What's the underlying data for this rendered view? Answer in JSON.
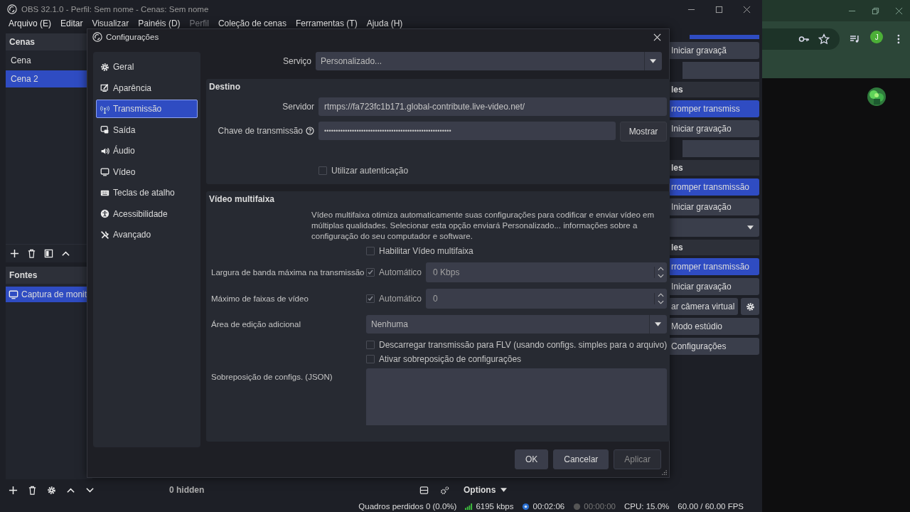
{
  "main_window": {
    "title": "OBS 32.1.0 - Perfil: Sem nome - Cenas: Sem nome",
    "menu": [
      {
        "label": "Arquivo (E)",
        "disabled": false
      },
      {
        "label": "Editar",
        "disabled": false
      },
      {
        "label": "Visualizar",
        "disabled": false
      },
      {
        "label": "Painéis (D)",
        "disabled": false
      },
      {
        "label": "Perfil",
        "disabled": true
      },
      {
        "label": "Coleção de cenas",
        "disabled": false
      },
      {
        "label": "Ferramentas (T)",
        "disabled": false
      },
      {
        "label": "Ajuda (H)",
        "disabled": false
      }
    ],
    "scenes": {
      "title": "Cenas",
      "items": [
        {
          "label": "Cena",
          "selected": false
        },
        {
          "label": "Cena 2",
          "selected": true
        }
      ]
    },
    "sources": {
      "title": "Fontes",
      "items": [
        {
          "label": "Captura de monit",
          "selected": true
        }
      ]
    },
    "controls_dock": [
      {
        "kind": "bar",
        "selected": true
      },
      {
        "kind": "button",
        "label": "Iniciar gravaçã",
        "selected": false
      },
      {
        "kind": "bar",
        "selected": false
      },
      {
        "kind": "header",
        "label": "les"
      },
      {
        "kind": "button",
        "label": "rromper transmiss",
        "selected": true
      },
      {
        "kind": "button",
        "label": "Iniciar gravação",
        "selected": false
      },
      {
        "kind": "bar",
        "selected": false
      },
      {
        "kind": "header",
        "label": "les"
      },
      {
        "kind": "button",
        "label": "rromper transmissão",
        "selected": true
      },
      {
        "kind": "button",
        "label": "Iniciar gravação",
        "selected": false
      },
      {
        "kind": "dropdown"
      },
      {
        "kind": "header",
        "label": "les"
      },
      {
        "kind": "button",
        "label": "rromper transmissão",
        "selected": true
      },
      {
        "kind": "button",
        "label": "Iniciar gravação",
        "selected": false
      },
      {
        "kind": "gear_button",
        "label": "ar câmera virtual"
      },
      {
        "kind": "button",
        "label": "Modo estúdio",
        "selected": false
      },
      {
        "kind": "button",
        "label": "Configurações",
        "selected": false
      }
    ],
    "hidden_count": "0 hidden",
    "options_label": "Options",
    "status_bar": [
      {
        "kind": "text",
        "label": "Quadros perdidos 0 (0.0%)"
      },
      {
        "kind": "bitrate",
        "label": "6195 kbps"
      },
      {
        "kind": "stream_time",
        "label": "00:02:06"
      },
      {
        "kind": "record_time",
        "label": "00:00:00"
      },
      {
        "kind": "text",
        "label": "CPU: 15.0%"
      },
      {
        "kind": "text",
        "label": "60.00 / 60.00 FPS"
      }
    ]
  },
  "browser": {
    "avatar_letter": "J"
  },
  "dialog": {
    "title": "Configurações",
    "nav": [
      {
        "label": "Geral",
        "selected": false
      },
      {
        "label": "Aparência",
        "selected": false
      },
      {
        "label": "Transmissão",
        "selected": true
      },
      {
        "label": "Saída",
        "selected": false
      },
      {
        "label": "Áudio",
        "selected": false
      },
      {
        "label": "Vídeo",
        "selected": false
      },
      {
        "label": "Teclas de atalho",
        "selected": false
      },
      {
        "label": "Acessibilidade",
        "selected": false
      },
      {
        "label": "Avançado",
        "selected": false
      }
    ],
    "service": {
      "label": "Serviço",
      "value": "Personalizado..."
    },
    "destination": {
      "title": "Destino",
      "server": {
        "label": "Servidor",
        "value": "rtmps://fa723fc1b171.global-contribute.live-video.net/"
      },
      "key": {
        "label": "Chave de transmissão",
        "value": "•••••••••••••••••••••••••••••••••••••••••••••••••••••••",
        "button": "Mostrar"
      },
      "auth": {
        "label": "Utilizar autenticação",
        "checked": false
      }
    },
    "multitrack": {
      "title": "Vídeo multifaixa",
      "description": "Vídeo multifaixa otimiza automaticamente suas configurações para codificar e enviar vídeo em múltiplas qualidades. Selecionar esta opção enviará Personalizado... informações sobre a configuração do seu computador e software.",
      "enable": {
        "label": "Habilitar Vídeo multifaixa",
        "checked": false
      },
      "bandwidth": {
        "label": "Largura de banda máxima na transmissão",
        "auto_label": "Automático",
        "auto_checked": true,
        "value": "0 Kbps"
      },
      "max_tracks": {
        "label": "Máximo de faixas de vídeo",
        "auto_label": "Automático",
        "auto_checked": true,
        "value": "0"
      },
      "extra_canvas": {
        "label": "Área de edição adicional",
        "value": "Nenhuma"
      },
      "dump_flv": {
        "label": "Descarregar transmissão para FLV (usando configs. simples para o arquivo)",
        "checked": false
      },
      "override": {
        "label": "Ativar sobreposição de configurações",
        "checked": false
      },
      "override_json": {
        "label": "Sobreposição de configs. (JSON)"
      }
    },
    "buttons": [
      {
        "label": "OK",
        "disabled": false
      },
      {
        "label": "Cancelar",
        "disabled": false
      },
      {
        "label": "Aplicar",
        "disabled": true
      }
    ]
  }
}
